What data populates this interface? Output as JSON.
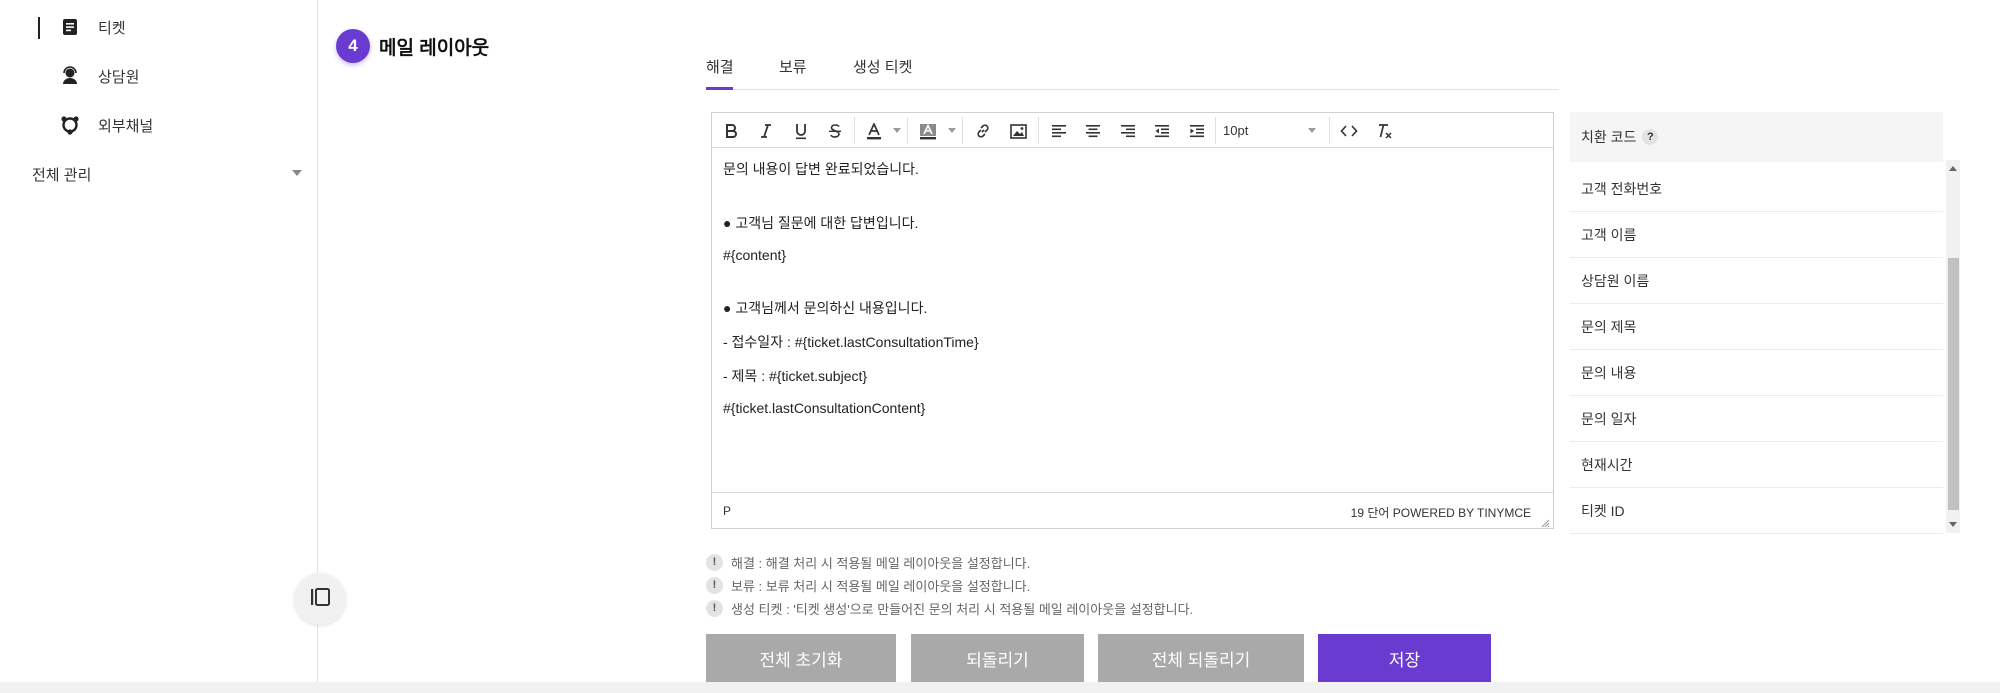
{
  "sidebar": {
    "items": [
      {
        "label": "티켓",
        "icon": "ticket-icon"
      },
      {
        "label": "상담원",
        "icon": "agent-icon"
      },
      {
        "label": "외부채널",
        "icon": "channel-icon"
      }
    ],
    "group_label": "전체 관리"
  },
  "section": {
    "step": "4",
    "title": "메일 레이아웃"
  },
  "tabs": [
    {
      "label": "해결",
      "active": true
    },
    {
      "label": "보류",
      "active": false
    },
    {
      "label": "생성 티켓",
      "active": false
    }
  ],
  "editor": {
    "font_size": "10pt",
    "lines": [
      "문의 내용이 답변 완료되었습니다.",
      "● 고객님 질문에 대한 답변입니다.",
      "#{content}",
      "● 고객님께서 문의하신 내용입니다.",
      "- 접수일자 : #{ticket.lastConsultationTime}",
      "- 제목 : #{ticket.subject}",
      "#{ticket.lastConsultationContent}"
    ],
    "status_path": "P",
    "status_right": "19 단어 POWERED BY TINYMCE"
  },
  "codes": {
    "header": "치환 코드",
    "help": "?",
    "items": [
      "고객 전화번호",
      "고객 이름",
      "상담원 이름",
      "문의 제목",
      "문의 내용",
      "문의 일자",
      "현재시간",
      "티켓 ID"
    ]
  },
  "notes": [
    "해결 : 해결 처리 시 적용될 메일 레이아웃을 설정합니다.",
    "보류 : 보류 처리 시 적용될 메일 레이아웃을 설정합니다.",
    "생성 티켓 : '티켓 생성'으로 만들어진 문의 처리 시 적용될 메일 레이아웃을 설정합니다."
  ],
  "buttons": {
    "reset_all": "전체 초기화",
    "revert": "되돌리기",
    "revert_all": "전체 되돌리기",
    "save": "저장"
  },
  "colors": {
    "accent": "#6a3bd1",
    "button_gray": "#a9a9a9"
  }
}
